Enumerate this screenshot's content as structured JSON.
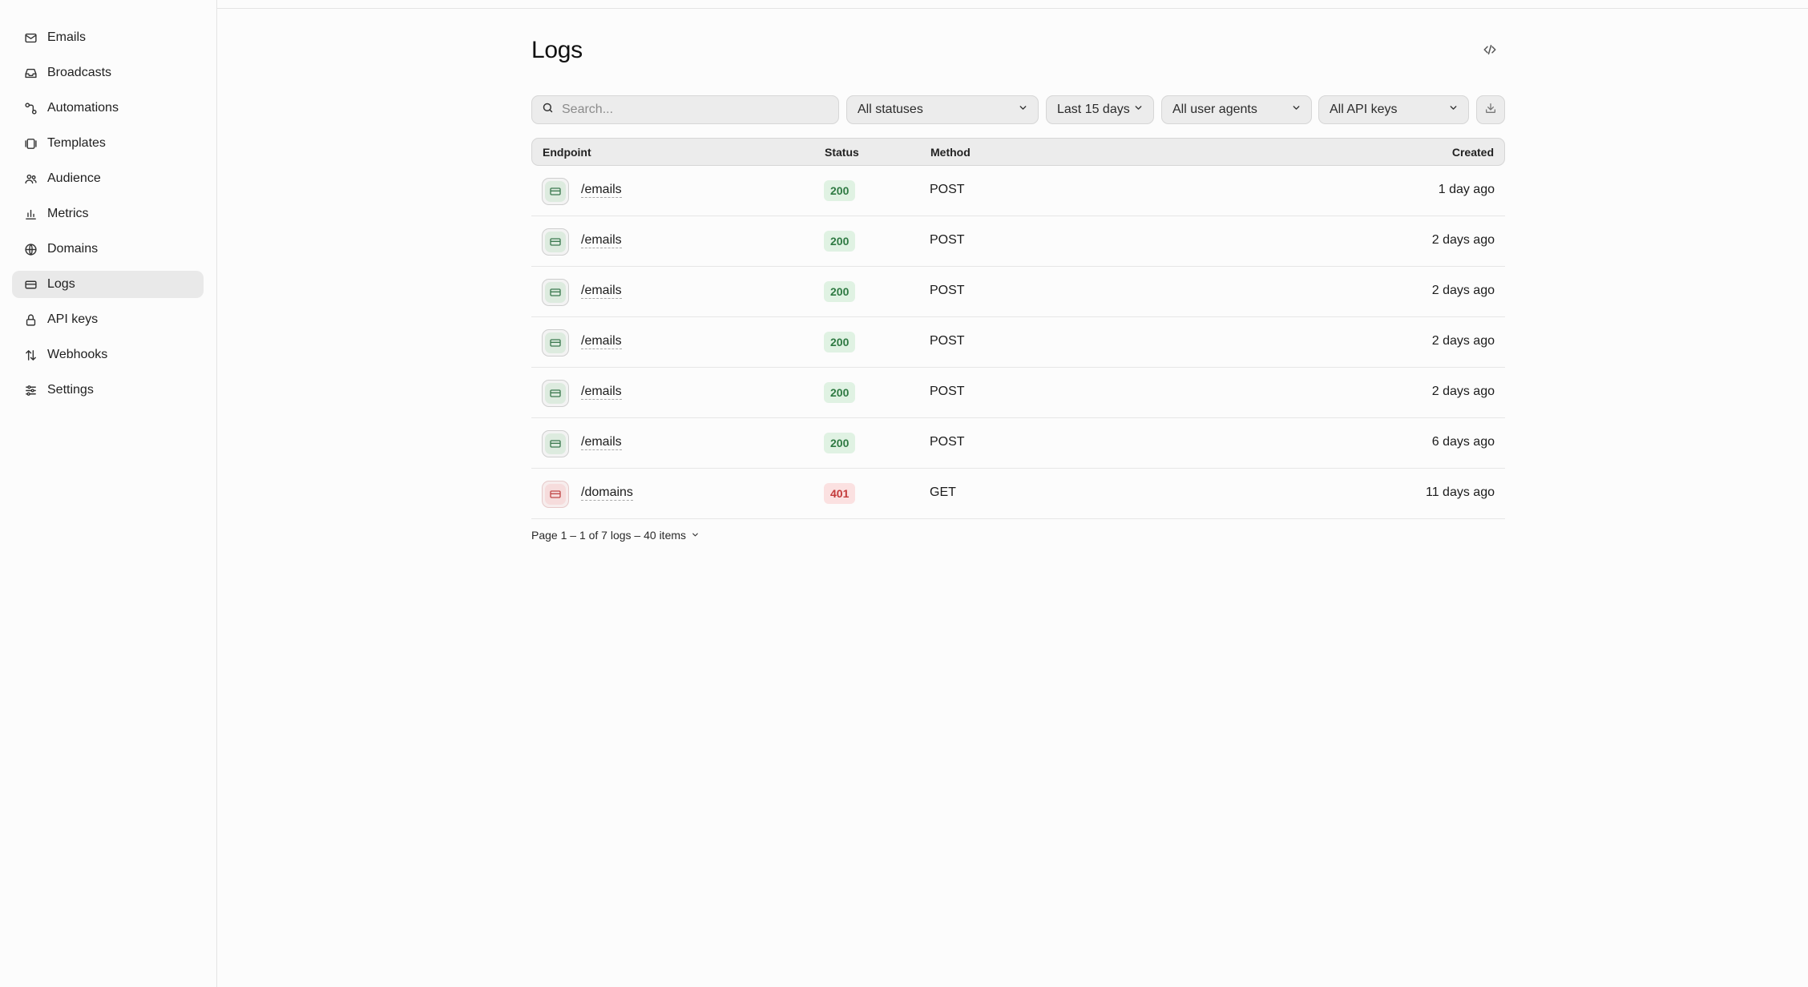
{
  "sidebar": {
    "items": [
      {
        "label": "Emails",
        "icon": "mail-icon"
      },
      {
        "label": "Broadcasts",
        "icon": "inbox-icon"
      },
      {
        "label": "Automations",
        "icon": "workflow-icon"
      },
      {
        "label": "Templates",
        "icon": "templates-icon"
      },
      {
        "label": "Audience",
        "icon": "users-icon"
      },
      {
        "label": "Metrics",
        "icon": "bar-chart-icon"
      },
      {
        "label": "Domains",
        "icon": "globe-icon"
      },
      {
        "label": "Logs",
        "icon": "logs-icon",
        "active": true
      },
      {
        "label": "API keys",
        "icon": "lock-icon"
      },
      {
        "label": "Webhooks",
        "icon": "webhook-icon"
      },
      {
        "label": "Settings",
        "icon": "sliders-icon"
      }
    ]
  },
  "page": {
    "title": "Logs"
  },
  "filters": {
    "search_placeholder": "Search...",
    "status": "All statuses",
    "date_range": "Last 15 days",
    "user_agents": "All user agents",
    "api_keys": "All API keys"
  },
  "table": {
    "headers": {
      "endpoint": "Endpoint",
      "status": "Status",
      "method": "Method",
      "created": "Created"
    },
    "rows": [
      {
        "endpoint": "/emails",
        "status": "200",
        "method": "POST",
        "created": "1 day ago"
      },
      {
        "endpoint": "/emails",
        "status": "200",
        "method": "POST",
        "created": "2 days ago"
      },
      {
        "endpoint": "/emails",
        "status": "200",
        "method": "POST",
        "created": "2 days ago"
      },
      {
        "endpoint": "/emails",
        "status": "200",
        "method": "POST",
        "created": "2 days ago"
      },
      {
        "endpoint": "/emails",
        "status": "200",
        "method": "POST",
        "created": "2 days ago"
      },
      {
        "endpoint": "/emails",
        "status": "200",
        "method": "POST",
        "created": "6 days ago"
      },
      {
        "endpoint": "/domains",
        "status": "401",
        "method": "GET",
        "created": "11 days ago"
      }
    ]
  },
  "pagination": {
    "text": "Page 1 – 1 of 7 logs – 40 items"
  },
  "colors": {
    "success_badge_bg": "#e0f2e3",
    "success_badge_text": "#2f7a43",
    "error_badge_bg": "#fbe1e1",
    "error_badge_text": "#c33a3a",
    "active_nav_bg": "#e9e9e9"
  }
}
